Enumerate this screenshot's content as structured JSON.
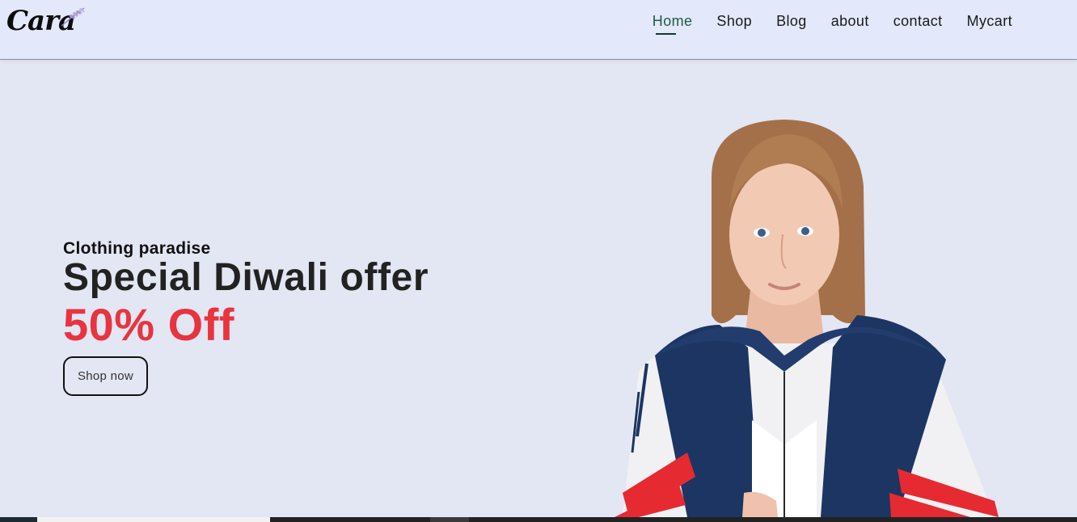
{
  "header": {
    "logo_text": "Cara",
    "nav": [
      {
        "label": "Home",
        "active": true
      },
      {
        "label": "Shop",
        "active": false
      },
      {
        "label": "Blog",
        "active": false
      },
      {
        "label": "about",
        "active": false
      },
      {
        "label": "contact",
        "active": false
      },
      {
        "label": "Mycart",
        "active": false
      }
    ]
  },
  "hero": {
    "tagline": "Clothing paradise",
    "headline": "Special Diwali offer",
    "discount": "50% Off",
    "cta_label": "Shop now",
    "image_icon": "model-photo"
  },
  "colors": {
    "page_bg": "#e3e6f3",
    "header_bg": "#e3e8fb",
    "accent_green": "#1d5b45",
    "discount_red": "#e8343f"
  }
}
